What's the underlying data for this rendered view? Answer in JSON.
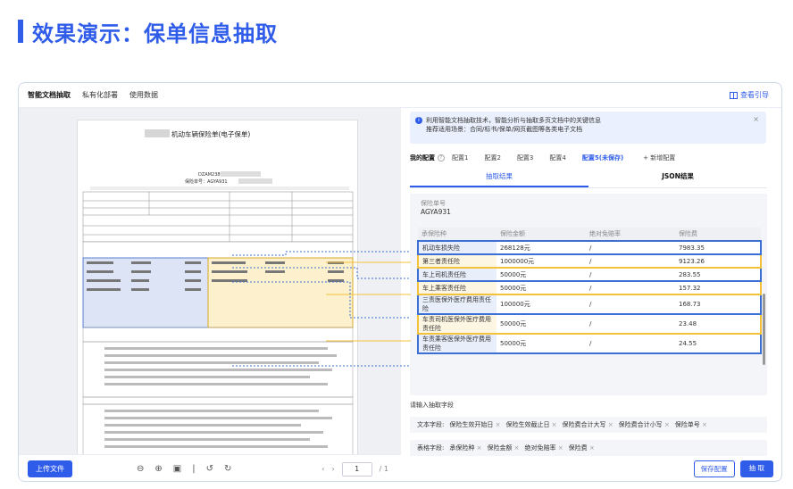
{
  "header": {
    "title": "效果演示：保单信息抽取"
  },
  "topnav": {
    "items": [
      "智能文档抽取",
      "私有化部署",
      "使用数据"
    ],
    "guide": "查看引导"
  },
  "document": {
    "title": "机动车辆保险单(电子保单)",
    "code": "DZAM2389",
    "policy_label": "保险单号：AGYA931"
  },
  "bottombar": {
    "upload": "上传文件",
    "page_current": "1",
    "page_total": "/ 1"
  },
  "info": {
    "line1": "利用智能文档抽取技术，智能分析与抽取多页文档中的关键信息",
    "line2": "推荐适用场景：合同/标书/保单/网页截图等各类电子文档"
  },
  "config_tabs": {
    "label": "我的配置",
    "items": [
      "配置1",
      "配置2",
      "配置3",
      "配置4",
      "配置5(未保存)"
    ],
    "add": "+ 新增配置"
  },
  "subtabs": {
    "result": "抽取结果",
    "json": "JSON结果"
  },
  "result": {
    "policy_no_label": "保险单号",
    "policy_no": "AGYA931",
    "columns": [
      "承保险种",
      "保险金额",
      "绝对免赔率",
      "保险费"
    ],
    "rows": [
      {
        "kind": "机动车损失险",
        "amount": "268128元",
        "deductible": "/",
        "premium": "7983.35"
      },
      {
        "kind": "第三者责任险",
        "amount": "1000000元",
        "deductible": "/",
        "premium": "9123.26"
      },
      {
        "kind": "车上司机责任险",
        "amount": "50000元",
        "deductible": "/",
        "premium": "283.55"
      },
      {
        "kind": "车上乘客责任险",
        "amount": "50000元",
        "deductible": "/",
        "premium": "157.32"
      },
      {
        "kind": "三责医保外医疗费用责任险",
        "amount": "100000元",
        "deductible": "/",
        "premium": "168.73"
      },
      {
        "kind": "车责司机医保外医疗费用责任险",
        "amount": "50000元",
        "deductible": "/",
        "premium": "23.48"
      },
      {
        "kind": "车责乘客医保外医疗费用责任险",
        "amount": "50000元",
        "deductible": "/",
        "premium": "24.55"
      }
    ]
  },
  "fields": {
    "prompt": "请输入抽取字段",
    "text_label": "文本字段:",
    "text_items": [
      "保险生效开始日",
      "保险生效截止日",
      "保险费合计大写",
      "保险费合计小写",
      "保险单号"
    ],
    "table_label": "表格字段:",
    "table_items": [
      "承保险种",
      "保险金额",
      "绝对免赔率",
      "保险费"
    ]
  },
  "actions": {
    "save": "保存配置",
    "run": "抽 取"
  },
  "colors": {
    "accent": "#2f5ce9",
    "blue_box": "#3b6fd6",
    "orange_box": "#f4c23a"
  }
}
